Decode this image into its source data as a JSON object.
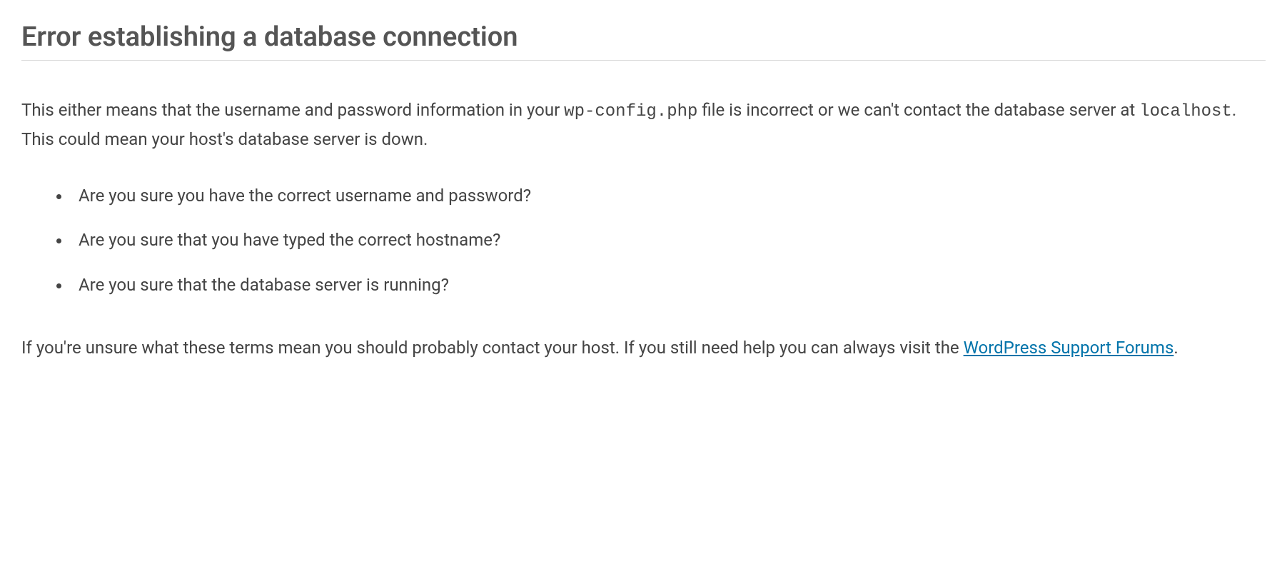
{
  "heading": "Error establishing a database connection",
  "intro": {
    "part1": "This either means that the username and password information in your ",
    "code1": "wp-config.php",
    "part2": " file is incorrect or we can't contact the database server at ",
    "code2": "localhost",
    "part3": ". This could mean your host's database server is down."
  },
  "checks": [
    "Are you sure you have the correct username and password?",
    "Are you sure that you have typed the correct hostname?",
    "Are you sure that the database server is running?"
  ],
  "footer": {
    "part1": "If you're unsure what these terms mean you should probably contact your host. If you still need help you can always visit the ",
    "link_text": "WordPress Support Forums",
    "part2": "."
  }
}
